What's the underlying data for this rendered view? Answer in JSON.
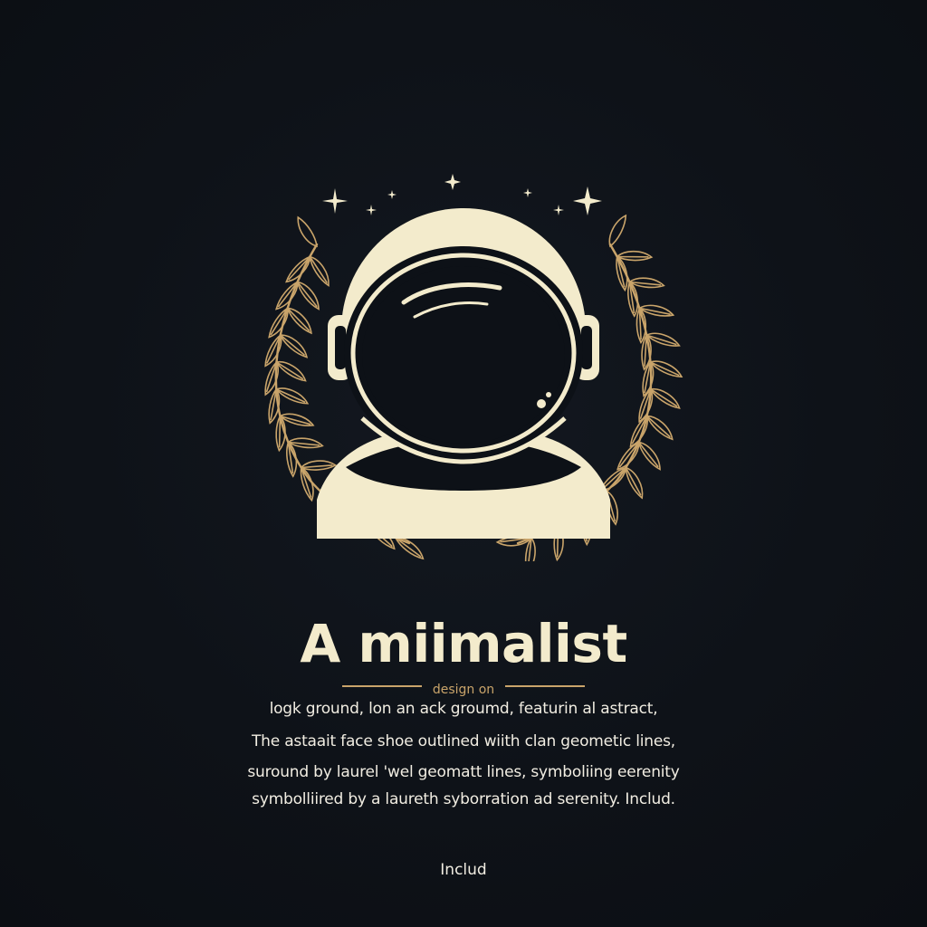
{
  "colors": {
    "background": "#0d1117",
    "cream": "#f3ebcc",
    "gold": "#c9a46a",
    "text": "#f1ede2"
  },
  "emblem": {
    "icons": [
      "astronaut-helmet-icon",
      "laurel-wreath-icon",
      "star-icon"
    ]
  },
  "headline": "A miimalist",
  "subline": "design on",
  "body_lines": [
    "logk ground,  lon   an ack groumd, featurin al astract,",
    "The astaait face shoe outlined wiith clan geometic lines,",
    "suround by laurel 'wel  geomatt lines, symboliing eerenity",
    "symbolliired by a  laureth  syborration ad serenity.  Includ."
  ],
  "footer": "Includ"
}
